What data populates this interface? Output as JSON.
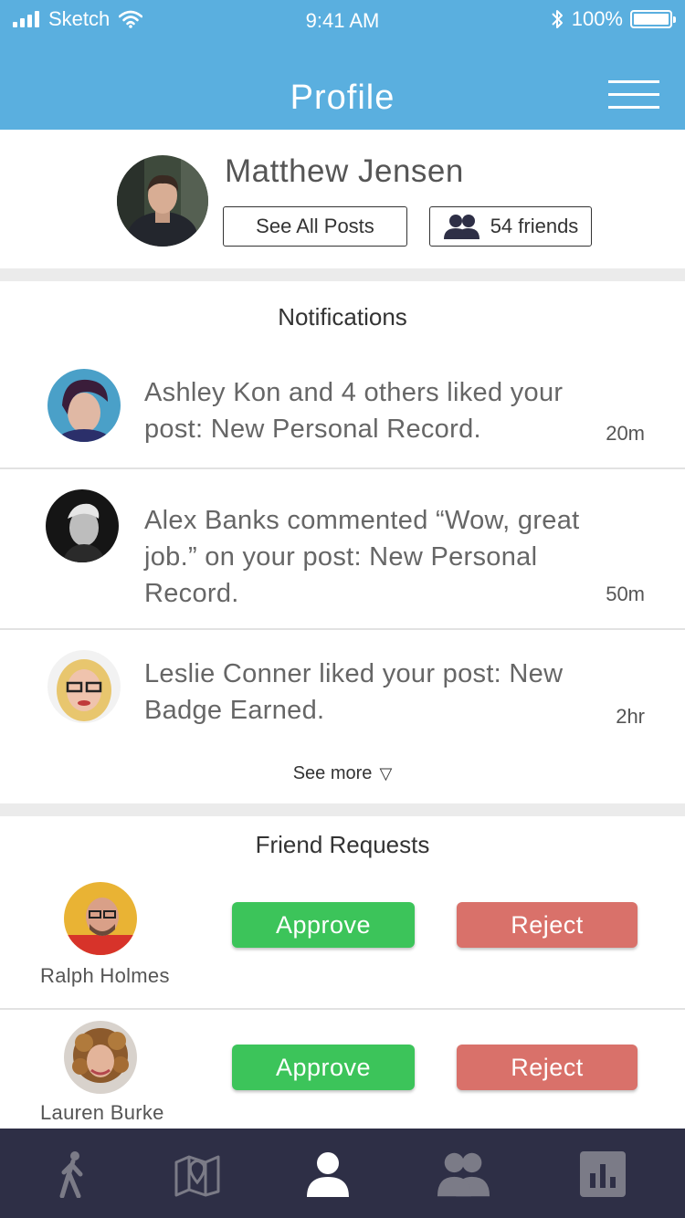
{
  "status_bar": {
    "carrier": "Sketch",
    "time": "9:41 AM",
    "battery": "100%"
  },
  "header": {
    "title": "Profile",
    "menu_icon": "hamburger-menu-icon"
  },
  "profile": {
    "name": "Matthew Jensen",
    "see_posts_label": "See All Posts",
    "friends_label": "54 friends"
  },
  "notifications": {
    "title": "Notifications",
    "items": [
      {
        "text": "Ashley Kon and 4 others liked your post: New Personal Record.",
        "time": "20m"
      },
      {
        "text": "Alex Banks commented “Wow, great job.” on your post: New Personal Record.",
        "time": "50m"
      },
      {
        "text": "Leslie Conner liked your post: New Badge Earned.",
        "time": "2hr"
      }
    ],
    "see_more_label": "See more"
  },
  "friend_requests": {
    "title": "Friend Requests",
    "items": [
      {
        "name": "Ralph Holmes",
        "approve_label": "Approve",
        "reject_label": "Reject"
      },
      {
        "name": "Lauren Burke",
        "approve_label": "Approve",
        "reject_label": "Reject"
      }
    ]
  },
  "tab_bar": {
    "tabs": [
      {
        "icon": "walking-person-icon",
        "active": false
      },
      {
        "icon": "map-icon",
        "active": false
      },
      {
        "icon": "profile-person-icon",
        "active": true
      },
      {
        "icon": "friends-group-icon",
        "active": false
      },
      {
        "icon": "bar-chart-icon",
        "active": false
      }
    ]
  },
  "colors": {
    "header_blue": "#5aafdf",
    "approve_green": "#3cc45a",
    "reject_red": "#d9716a",
    "tabbar_dark": "#2e2f46"
  }
}
